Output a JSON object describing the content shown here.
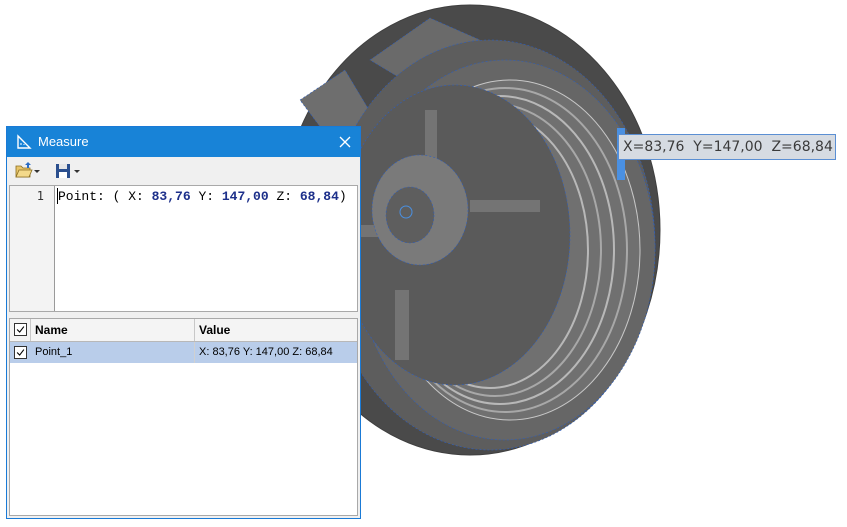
{
  "window": {
    "title": "Measure",
    "close_icon": "close-icon",
    "title_icon": "ruler-triangle-icon"
  },
  "toolbar": {
    "open_icon": "folder-open-icon",
    "save_icon": "save-disk-icon",
    "dropdown_icon": "chevron-down-icon"
  },
  "editor": {
    "line_number": "1",
    "tokens": [
      {
        "text": "Point: ( ",
        "color": "#000000",
        "bold": false
      },
      {
        "text": "X:",
        "color": "#000000",
        "bold": false
      },
      {
        "text": " 83,76 ",
        "color": "#1c2f8a",
        "bold": true
      },
      {
        "text": "Y:",
        "color": "#000000",
        "bold": false
      },
      {
        "text": " 147,00 ",
        "color": "#1c2f8a",
        "bold": true
      },
      {
        "text": "Z:",
        "color": "#000000",
        "bold": false
      },
      {
        "text": " 68,84",
        "color": "#1c2f8a",
        "bold": true
      },
      {
        "text": ")",
        "color": "#000000",
        "bold": false
      }
    ]
  },
  "grid": {
    "columns": {
      "name": "Name",
      "value": "Value"
    },
    "header_checked": true,
    "rows": [
      {
        "checked": true,
        "name": "Point_1",
        "value": "X: 83,76 Y: 147,00 Z: 68,84",
        "selected": true
      }
    ]
  },
  "viewport": {
    "coord_label": "X=83,76  Y=147,00  Z=68,84",
    "model_color": "#5a5a5a",
    "edge_color": "#2d5fbf",
    "highlight_color": "#4a90e2"
  }
}
